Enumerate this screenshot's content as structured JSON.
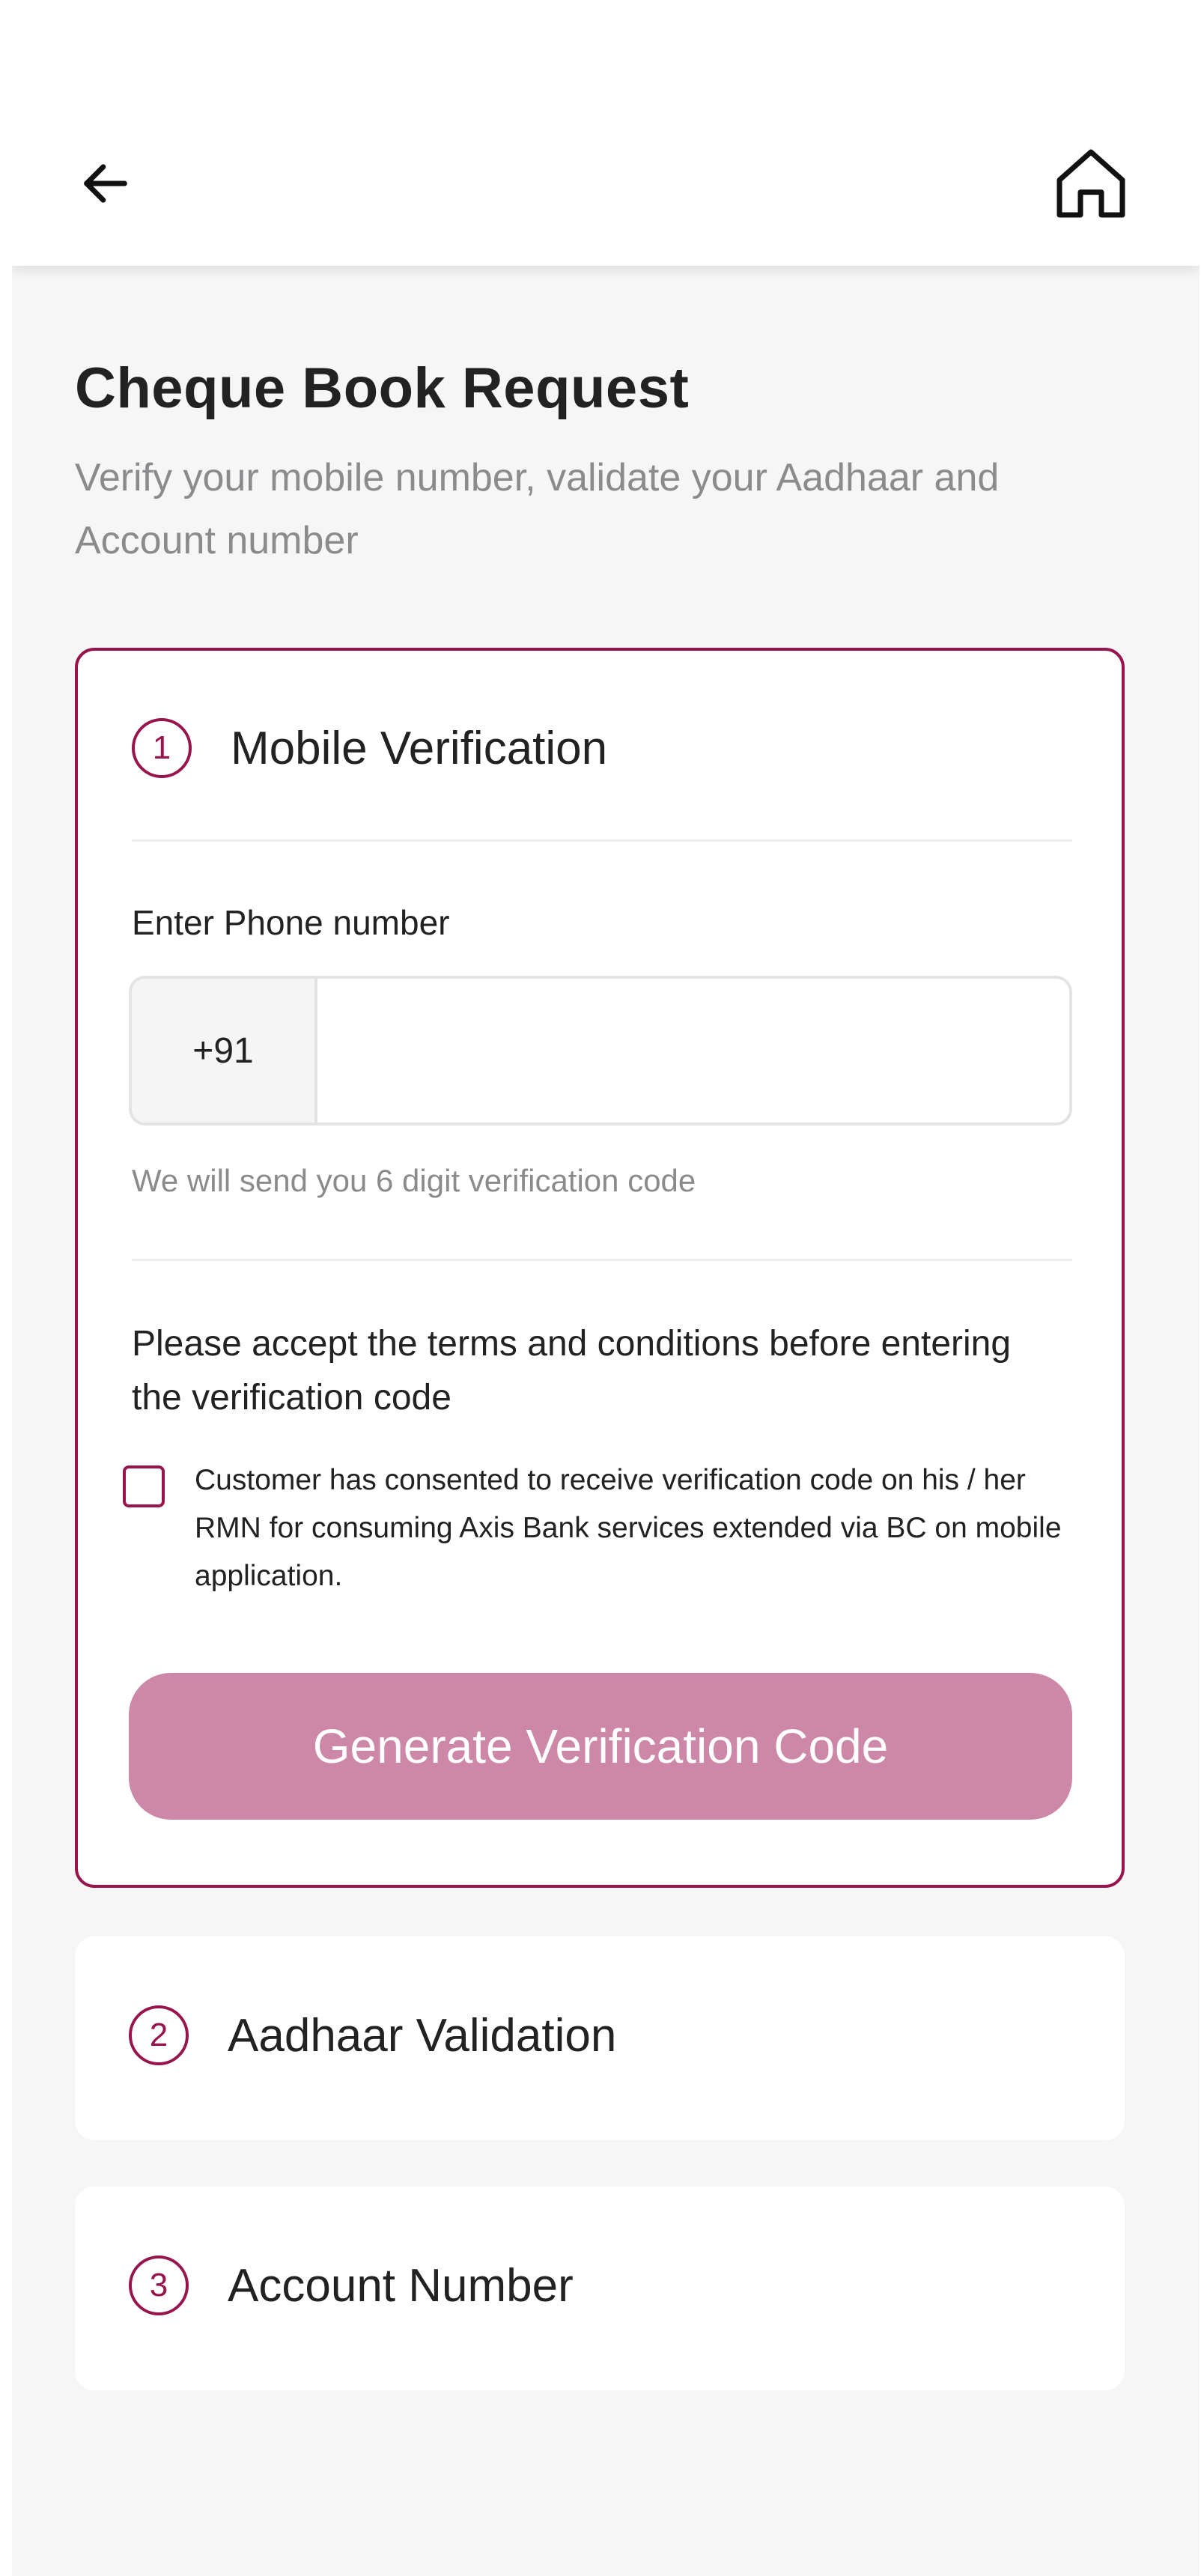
{
  "header": {
    "back_icon": "arrow-left-icon",
    "home_icon": "home-icon"
  },
  "page": {
    "title": "Cheque Book Request",
    "subtitle": "Verify your mobile number, validate your Aadhaar and Account number"
  },
  "steps": [
    {
      "number": "1",
      "title": "Mobile Verification",
      "expanded": true,
      "phone": {
        "label": "Enter Phone number",
        "country_code": "+91",
        "value": "",
        "placeholder": "",
        "helper": "We will send you 6 digit verification code"
      },
      "terms_heading": "Please accept the terms and conditions before entering the verification code",
      "consent_checked": false,
      "consent_text": "Customer has consented to receive verification code on his / her RMN for consuming Axis Bank services extended via BC on mobile application.",
      "button_label": "Generate Verification Code",
      "button_enabled": false
    },
    {
      "number": "2",
      "title": "Aadhaar Validation",
      "expanded": false
    },
    {
      "number": "3",
      "title": "Account Number",
      "expanded": false
    }
  ],
  "colors": {
    "accent": "#97144d",
    "button_disabled": "#cc88a6",
    "background": "#f7f6f7",
    "muted_text": "#8b8b8e"
  }
}
